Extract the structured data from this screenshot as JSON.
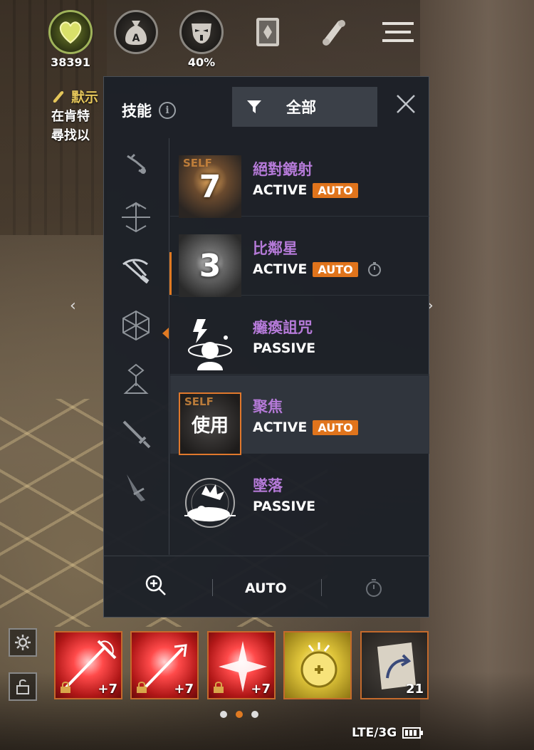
{
  "hud": {
    "currency_value": "38391",
    "buff_percent": "40%"
  },
  "quest": {
    "title": "默示",
    "desc_line1": "在肯特",
    "desc_line2": "尋找以"
  },
  "panel": {
    "title": "技能",
    "filter_label": "全部",
    "categories": [
      "stance",
      "bow-skills",
      "crossbow-skills",
      "crystal-skills",
      "totem-skills",
      "sword-skills",
      "dagger-skills"
    ],
    "skills": [
      {
        "name": "絕對鏡射",
        "type": "ACTIVE",
        "auto": "AUTO",
        "tag": "SELF",
        "cooldown": "7"
      },
      {
        "name": "比鄰星",
        "type": "ACTIVE",
        "auto": "AUTO",
        "cooldown": "3"
      },
      {
        "name": "癱瘓詛咒",
        "type": "PASSIVE"
      },
      {
        "name": "聚焦",
        "type": "ACTIVE",
        "auto": "AUTO",
        "tag": "SELF",
        "use_label": "使用"
      },
      {
        "name": "墜落",
        "type": "PASSIVE"
      }
    ],
    "footer": {
      "auto_label": "AUTO"
    }
  },
  "quickslots": [
    {
      "kind": "red",
      "count": "+7",
      "locked": true
    },
    {
      "kind": "red",
      "count": "+7",
      "locked": true
    },
    {
      "kind": "red",
      "count": "+7",
      "locked": true
    },
    {
      "kind": "gold",
      "count": "",
      "locked": false
    },
    {
      "kind": "dark",
      "count": "21",
      "locked": false
    }
  ],
  "status": {
    "network": "LTE/3G"
  },
  "colors": {
    "accent": "#e07a22",
    "skill_name": "#b57ad8",
    "panel_bg": "#1c2028"
  }
}
